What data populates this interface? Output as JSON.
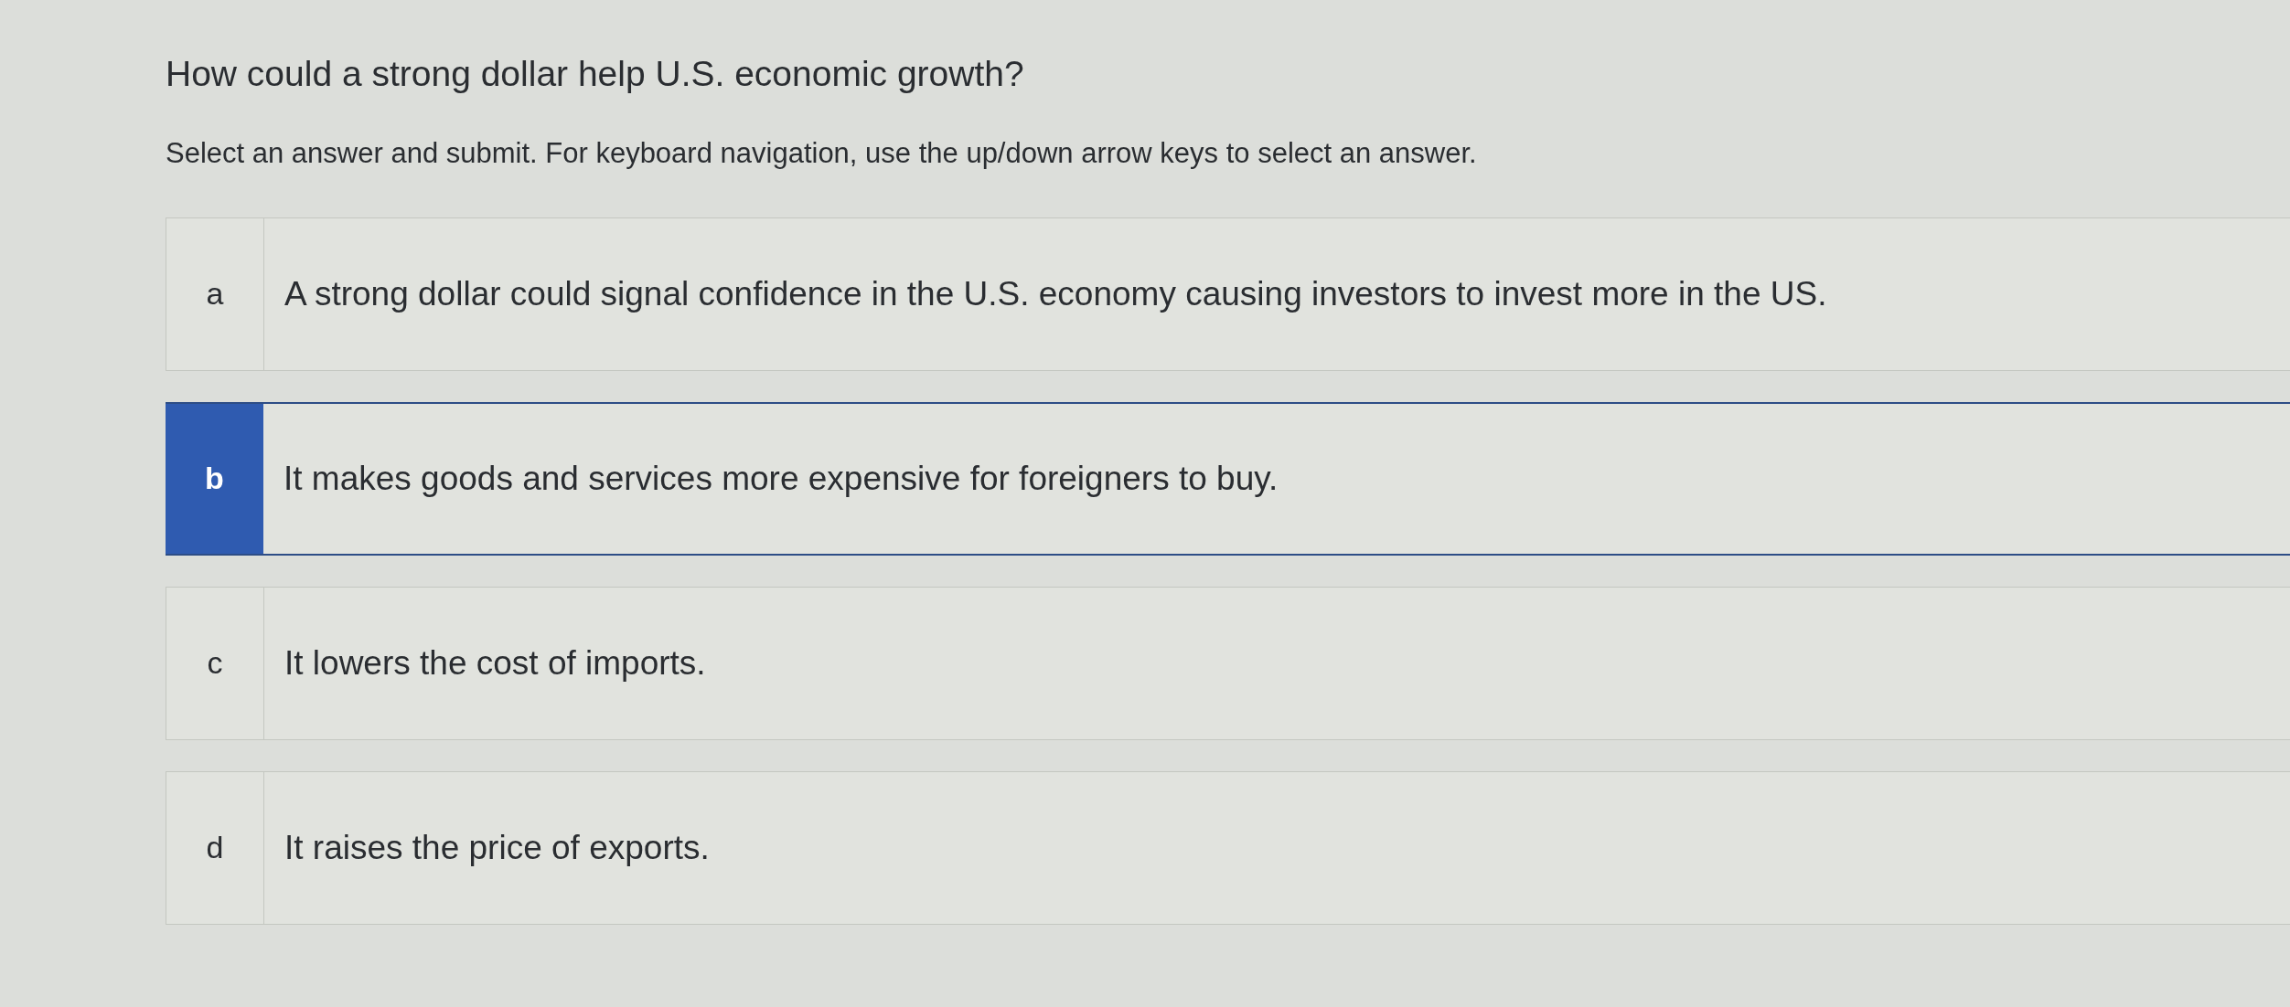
{
  "question": "How could a strong dollar help U.S. economic growth?",
  "instructions": "Select an answer and submit. For keyboard navigation, use the up/down arrow keys to select an answer.",
  "options": [
    {
      "letter": "a",
      "text": "A strong dollar could signal confidence in the U.S. economy causing investors to invest more in the US.",
      "selected": false
    },
    {
      "letter": "b",
      "text": "It makes goods and services more expensive for foreigners to buy.",
      "selected": true
    },
    {
      "letter": "c",
      "text": "It lowers the cost of imports.",
      "selected": false
    },
    {
      "letter": "d",
      "text": "It raises the price of exports.",
      "selected": false
    }
  ]
}
